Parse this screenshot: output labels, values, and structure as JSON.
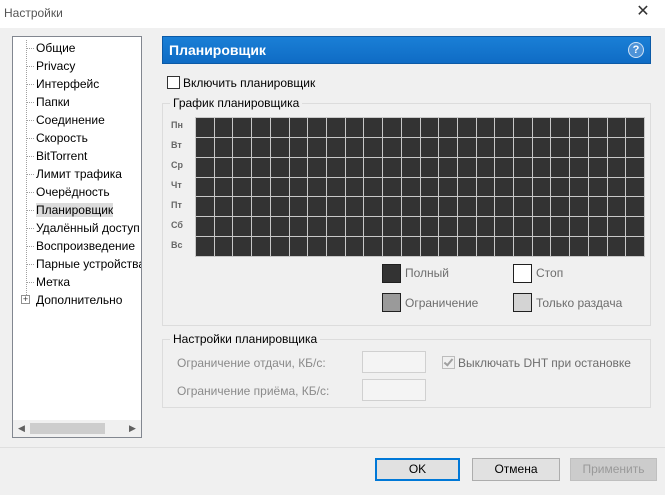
{
  "window": {
    "title": "Настройки",
    "close_glyph": "✕"
  },
  "tree": {
    "items": [
      {
        "label": "Общие"
      },
      {
        "label": "Privacy"
      },
      {
        "label": "Интерфейс"
      },
      {
        "label": "Папки"
      },
      {
        "label": "Соединение"
      },
      {
        "label": "Скорость"
      },
      {
        "label": "BitTorrent"
      },
      {
        "label": "Лимит трафика"
      },
      {
        "label": "Очерёдность"
      },
      {
        "label": "Планировщик"
      },
      {
        "label": "Удалённый доступ"
      },
      {
        "label": "Воспроизведение"
      },
      {
        "label": "Парные устройства"
      },
      {
        "label": "Метка"
      },
      {
        "label": "Дополнительно"
      }
    ],
    "selected": "Планировщик",
    "expander_glyph": "+"
  },
  "header": {
    "title": "Планировщик",
    "help_glyph": "?"
  },
  "enable": {
    "label": "Включить планировщик",
    "checked": false
  },
  "schedule": {
    "group_title": "График планировщика",
    "days": [
      "Пн",
      "Вт",
      "Ср",
      "Чт",
      "Пт",
      "Сб",
      "Вс"
    ],
    "legend": {
      "full": "Полный",
      "stop": "Стоп",
      "limit": "Ограничение",
      "seed": "Только раздача"
    },
    "colors": {
      "full": "#333333",
      "stop": "#ffffff",
      "limit": "#9a9a9a",
      "seed": "#d4d4d4"
    }
  },
  "settings": {
    "group_title": "Настройки планировщика",
    "upload_label": "Ограничение отдачи, КБ/с:",
    "download_label": "Ограничение приёма, КБ/с:",
    "dht_label": "Выключать DHT при остановке",
    "upload_value": "",
    "download_value": ""
  },
  "buttons": {
    "ok": "OK",
    "cancel": "Отмена",
    "apply": "Применить"
  },
  "colors": {
    "accent": "#1a7fd6"
  }
}
